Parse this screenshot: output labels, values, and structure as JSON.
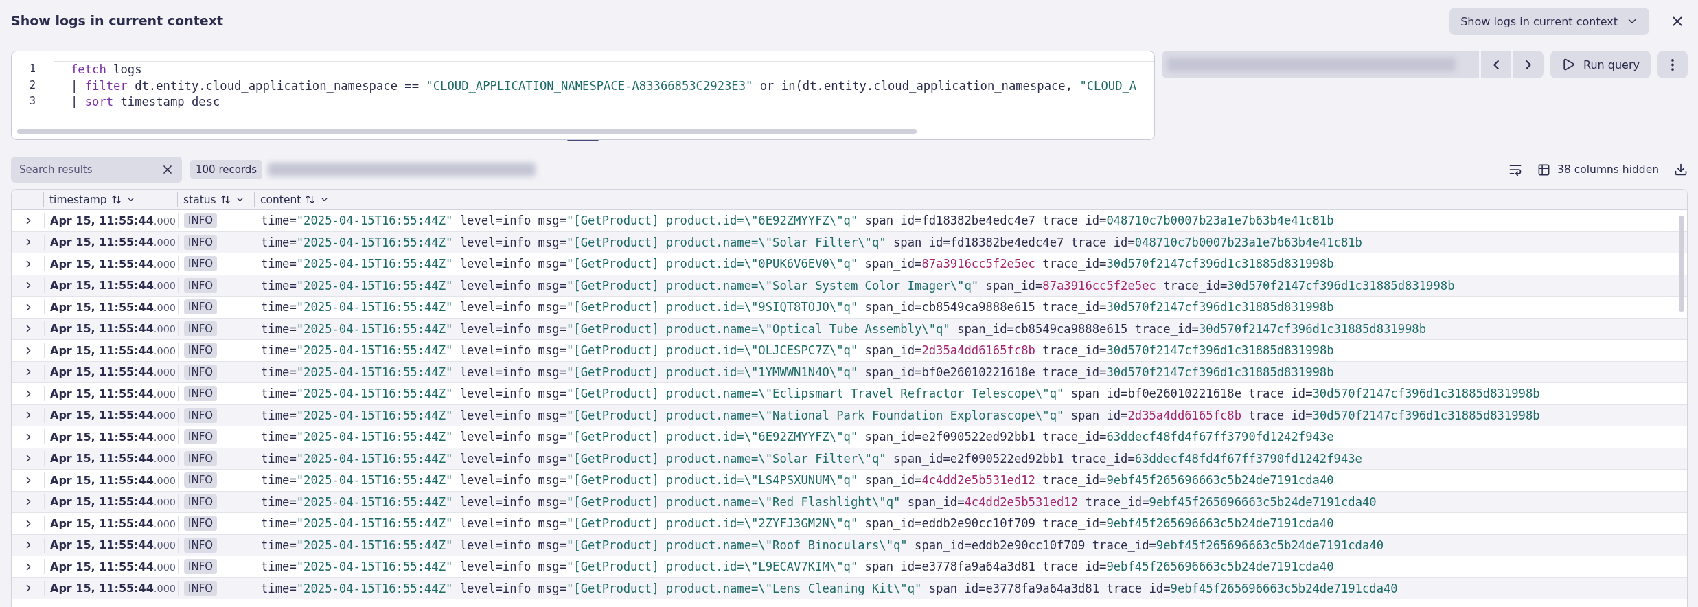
{
  "header": {
    "title": "Show logs in current context",
    "context_button": "Show logs in current context"
  },
  "editor": {
    "lines": [
      {
        "number": "1",
        "parts": [
          {
            "text": "fetch",
            "kind": "keyword"
          },
          {
            "text": " logs",
            "kind": "plain"
          }
        ]
      },
      {
        "number": "2",
        "parts": [
          {
            "text": "| ",
            "kind": "plain"
          },
          {
            "text": "filter",
            "kind": "keyword"
          },
          {
            "text": " dt.entity.cloud_application_namespace == ",
            "kind": "plain"
          },
          {
            "text": "\"CLOUD_APPLICATION_NAMESPACE-A83366853C2923E3\"",
            "kind": "string"
          },
          {
            "text": " or in(dt.entity.cloud_application_namespace, ",
            "kind": "plain"
          },
          {
            "text": "\"CLOUD_A",
            "kind": "string"
          }
        ]
      },
      {
        "number": "3",
        "parts": [
          {
            "text": "| ",
            "kind": "plain"
          },
          {
            "text": "sort",
            "kind": "keyword"
          },
          {
            "text": " timestamp desc",
            "kind": "plain"
          }
        ]
      }
    ]
  },
  "query_bar": {
    "run_button": "Run query"
  },
  "results_toolbar": {
    "search": {
      "placeholder": "Search results"
    },
    "records": "100 records",
    "hidden_columns": "38 columns hidden"
  },
  "table": {
    "columns": [
      "timestamp",
      "status",
      "content"
    ],
    "rows": [
      {
        "timestamp": "Apr 15, 11:55:44",
        "millis": ".000",
        "status": "INFO",
        "content": [
          {
            "text": "time=",
            "kind": "plain"
          },
          {
            "text": "\"2025-04-15T16:55:44Z\"",
            "kind": "string"
          },
          {
            "text": " level=info msg=",
            "kind": "plain"
          },
          {
            "text": "\"[GetProduct] product.id=\\\"6E92ZMYYFZ\\\"q\"",
            "kind": "string"
          },
          {
            "text": " span_id=fd18382be4edc4e7 trace_id=",
            "kind": "plain"
          },
          {
            "text": "048710c7b0007b23a1e7b63b4e41c81b",
            "kind": "string"
          }
        ]
      },
      {
        "timestamp": "Apr 15, 11:55:44",
        "millis": ".000",
        "status": "INFO",
        "content": [
          {
            "text": "time=",
            "kind": "plain"
          },
          {
            "text": "\"2025-04-15T16:55:44Z\"",
            "kind": "string"
          },
          {
            "text": " level=info msg=",
            "kind": "plain"
          },
          {
            "text": "\"[GetProduct] product.name=\\\"Solar Filter\\\"q\"",
            "kind": "string"
          },
          {
            "text": " span_id=fd18382be4edc4e7 trace_id=",
            "kind": "plain"
          },
          {
            "text": "048710c7b0007b23a1e7b63b4e41c81b",
            "kind": "string"
          }
        ]
      },
      {
        "timestamp": "Apr 15, 11:55:44",
        "millis": ".000",
        "status": "INFO",
        "content": [
          {
            "text": "time=",
            "kind": "plain"
          },
          {
            "text": "\"2025-04-15T16:55:44Z\"",
            "kind": "string"
          },
          {
            "text": " level=info msg=",
            "kind": "plain"
          },
          {
            "text": "\"[GetProduct] product.id=\\\"0PUK6V6EV0\\\"q\"",
            "kind": "string"
          },
          {
            "text": " span_id=",
            "kind": "plain"
          },
          {
            "text": "87a3916cc5f2e5ec",
            "kind": "highlight"
          },
          {
            "text": " trace_id=",
            "kind": "plain"
          },
          {
            "text": "30d570f2147cf396d1c31885d831998b",
            "kind": "string"
          }
        ]
      },
      {
        "timestamp": "Apr 15, 11:55:44",
        "millis": ".000",
        "status": "INFO",
        "content": [
          {
            "text": "time=",
            "kind": "plain"
          },
          {
            "text": "\"2025-04-15T16:55:44Z\"",
            "kind": "string"
          },
          {
            "text": " level=info msg=",
            "kind": "plain"
          },
          {
            "text": "\"[GetProduct] product.name=\\\"Solar System Color Imager\\\"q\"",
            "kind": "string"
          },
          {
            "text": " span_id=",
            "kind": "plain"
          },
          {
            "text": "87a3916cc5f2e5ec",
            "kind": "highlight"
          },
          {
            "text": " trace_id=",
            "kind": "plain"
          },
          {
            "text": "30d570f2147cf396d1c31885d831998b",
            "kind": "string"
          }
        ]
      },
      {
        "timestamp": "Apr 15, 11:55:44",
        "millis": ".000",
        "status": "INFO",
        "content": [
          {
            "text": "time=",
            "kind": "plain"
          },
          {
            "text": "\"2025-04-15T16:55:44Z\"",
            "kind": "string"
          },
          {
            "text": " level=info msg=",
            "kind": "plain"
          },
          {
            "text": "\"[GetProduct] product.id=\\\"9SIQT8TOJO\\\"q\"",
            "kind": "string"
          },
          {
            "text": " span_id=cb8549ca9888e615 trace_id=",
            "kind": "plain"
          },
          {
            "text": "30d570f2147cf396d1c31885d831998b",
            "kind": "string"
          }
        ]
      },
      {
        "timestamp": "Apr 15, 11:55:44",
        "millis": ".000",
        "status": "INFO",
        "content": [
          {
            "text": "time=",
            "kind": "plain"
          },
          {
            "text": "\"2025-04-15T16:55:44Z\"",
            "kind": "string"
          },
          {
            "text": " level=info msg=",
            "kind": "plain"
          },
          {
            "text": "\"[GetProduct] product.name=\\\"Optical Tube Assembly\\\"q\"",
            "kind": "string"
          },
          {
            "text": " span_id=cb8549ca9888e615 trace_id=",
            "kind": "plain"
          },
          {
            "text": "30d570f2147cf396d1c31885d831998b",
            "kind": "string"
          }
        ]
      },
      {
        "timestamp": "Apr 15, 11:55:44",
        "millis": ".000",
        "status": "INFO",
        "content": [
          {
            "text": "time=",
            "kind": "plain"
          },
          {
            "text": "\"2025-04-15T16:55:44Z\"",
            "kind": "string"
          },
          {
            "text": " level=info msg=",
            "kind": "plain"
          },
          {
            "text": "\"[GetProduct] product.id=\\\"OLJCESPC7Z\\\"q\"",
            "kind": "string"
          },
          {
            "text": " span_id=",
            "kind": "plain"
          },
          {
            "text": "2d35a4dd6165fc8b",
            "kind": "highlight"
          },
          {
            "text": " trace_id=",
            "kind": "plain"
          },
          {
            "text": "30d570f2147cf396d1c31885d831998b",
            "kind": "string"
          }
        ]
      },
      {
        "timestamp": "Apr 15, 11:55:44",
        "millis": ".000",
        "status": "INFO",
        "content": [
          {
            "text": "time=",
            "kind": "plain"
          },
          {
            "text": "\"2025-04-15T16:55:44Z\"",
            "kind": "string"
          },
          {
            "text": " level=info msg=",
            "kind": "plain"
          },
          {
            "text": "\"[GetProduct] product.id=\\\"1YMWWN1N4O\\\"q\"",
            "kind": "string"
          },
          {
            "text": " span_id=bf0e26010221618e trace_id=",
            "kind": "plain"
          },
          {
            "text": "30d570f2147cf396d1c31885d831998b",
            "kind": "string"
          }
        ]
      },
      {
        "timestamp": "Apr 15, 11:55:44",
        "millis": ".000",
        "status": "INFO",
        "content": [
          {
            "text": "time=",
            "kind": "plain"
          },
          {
            "text": "\"2025-04-15T16:55:44Z\"",
            "kind": "string"
          },
          {
            "text": " level=info msg=",
            "kind": "plain"
          },
          {
            "text": "\"[GetProduct] product.name=\\\"Eclipsmart Travel Refractor Telescope\\\"q\"",
            "kind": "string"
          },
          {
            "text": " span_id=bf0e26010221618e trace_id=",
            "kind": "plain"
          },
          {
            "text": "30d570f2147cf396d1c31885d831998b",
            "kind": "string"
          }
        ]
      },
      {
        "timestamp": "Apr 15, 11:55:44",
        "millis": ".000",
        "status": "INFO",
        "content": [
          {
            "text": "time=",
            "kind": "plain"
          },
          {
            "text": "\"2025-04-15T16:55:44Z\"",
            "kind": "string"
          },
          {
            "text": " level=info msg=",
            "kind": "plain"
          },
          {
            "text": "\"[GetProduct] product.name=\\\"National Park Foundation Explorascope\\\"q\"",
            "kind": "string"
          },
          {
            "text": " span_id=",
            "kind": "plain"
          },
          {
            "text": "2d35a4dd6165fc8b",
            "kind": "highlight"
          },
          {
            "text": " trace_id=",
            "kind": "plain"
          },
          {
            "text": "30d570f2147cf396d1c31885d831998b",
            "kind": "string"
          }
        ]
      },
      {
        "timestamp": "Apr 15, 11:55:44",
        "millis": ".000",
        "status": "INFO",
        "content": [
          {
            "text": "time=",
            "kind": "plain"
          },
          {
            "text": "\"2025-04-15T16:55:44Z\"",
            "kind": "string"
          },
          {
            "text": " level=info msg=",
            "kind": "plain"
          },
          {
            "text": "\"[GetProduct] product.id=\\\"6E92ZMYYFZ\\\"q\"",
            "kind": "string"
          },
          {
            "text": " span_id=e2f090522ed92bb1 trace_id=",
            "kind": "plain"
          },
          {
            "text": "63ddecf48fd4f67ff3790fd1242f943e",
            "kind": "string"
          }
        ]
      },
      {
        "timestamp": "Apr 15, 11:55:44",
        "millis": ".000",
        "status": "INFO",
        "content": [
          {
            "text": "time=",
            "kind": "plain"
          },
          {
            "text": "\"2025-04-15T16:55:44Z\"",
            "kind": "string"
          },
          {
            "text": " level=info msg=",
            "kind": "plain"
          },
          {
            "text": "\"[GetProduct] product.name=\\\"Solar Filter\\\"q\"",
            "kind": "string"
          },
          {
            "text": " span_id=e2f090522ed92bb1 trace_id=",
            "kind": "plain"
          },
          {
            "text": "63ddecf48fd4f67ff3790fd1242f943e",
            "kind": "string"
          }
        ]
      },
      {
        "timestamp": "Apr 15, 11:55:44",
        "millis": ".000",
        "status": "INFO",
        "content": [
          {
            "text": "time=",
            "kind": "plain"
          },
          {
            "text": "\"2025-04-15T16:55:44Z\"",
            "kind": "string"
          },
          {
            "text": " level=info msg=",
            "kind": "plain"
          },
          {
            "text": "\"[GetProduct] product.id=\\\"LS4PSXUNUM\\\"q\"",
            "kind": "string"
          },
          {
            "text": " span_id=",
            "kind": "plain"
          },
          {
            "text": "4c4dd2e5b531ed12",
            "kind": "highlight"
          },
          {
            "text": " trace_id=",
            "kind": "plain"
          },
          {
            "text": "9ebf45f265696663c5b24de7191cda40",
            "kind": "string"
          }
        ]
      },
      {
        "timestamp": "Apr 15, 11:55:44",
        "millis": ".000",
        "status": "INFO",
        "content": [
          {
            "text": "time=",
            "kind": "plain"
          },
          {
            "text": "\"2025-04-15T16:55:44Z\"",
            "kind": "string"
          },
          {
            "text": " level=info msg=",
            "kind": "plain"
          },
          {
            "text": "\"[GetProduct] product.name=\\\"Red Flashlight\\\"q\"",
            "kind": "string"
          },
          {
            "text": " span_id=",
            "kind": "plain"
          },
          {
            "text": "4c4dd2e5b531ed12",
            "kind": "highlight"
          },
          {
            "text": " trace_id=",
            "kind": "plain"
          },
          {
            "text": "9ebf45f265696663c5b24de7191cda40",
            "kind": "string"
          }
        ]
      },
      {
        "timestamp": "Apr 15, 11:55:44",
        "millis": ".000",
        "status": "INFO",
        "content": [
          {
            "text": "time=",
            "kind": "plain"
          },
          {
            "text": "\"2025-04-15T16:55:44Z\"",
            "kind": "string"
          },
          {
            "text": " level=info msg=",
            "kind": "plain"
          },
          {
            "text": "\"[GetProduct] product.id=\\\"2ZYFJ3GM2N\\\"q\"",
            "kind": "string"
          },
          {
            "text": " span_id=eddb2e90cc10f709 trace_id=",
            "kind": "plain"
          },
          {
            "text": "9ebf45f265696663c5b24de7191cda40",
            "kind": "string"
          }
        ]
      },
      {
        "timestamp": "Apr 15, 11:55:44",
        "millis": ".000",
        "status": "INFO",
        "content": [
          {
            "text": "time=",
            "kind": "plain"
          },
          {
            "text": "\"2025-04-15T16:55:44Z\"",
            "kind": "string"
          },
          {
            "text": " level=info msg=",
            "kind": "plain"
          },
          {
            "text": "\"[GetProduct] product.name=\\\"Roof Binoculars\\\"q\"",
            "kind": "string"
          },
          {
            "text": " span_id=eddb2e90cc10f709 trace_id=",
            "kind": "plain"
          },
          {
            "text": "9ebf45f265696663c5b24de7191cda40",
            "kind": "string"
          }
        ]
      },
      {
        "timestamp": "Apr 15, 11:55:44",
        "millis": ".000",
        "status": "INFO",
        "content": [
          {
            "text": "time=",
            "kind": "plain"
          },
          {
            "text": "\"2025-04-15T16:55:44Z\"",
            "kind": "string"
          },
          {
            "text": " level=info msg=",
            "kind": "plain"
          },
          {
            "text": "\"[GetProduct] product.id=\\\"L9ECAV7KIM\\\"q\"",
            "kind": "string"
          },
          {
            "text": " span_id=e3778fa9a64a3d81 trace_id=",
            "kind": "plain"
          },
          {
            "text": "9ebf45f265696663c5b24de7191cda40",
            "kind": "string"
          }
        ]
      },
      {
        "timestamp": "Apr 15, 11:55:44",
        "millis": ".000",
        "status": "INFO",
        "content": [
          {
            "text": "time=",
            "kind": "plain"
          },
          {
            "text": "\"2025-04-15T16:55:44Z\"",
            "kind": "string"
          },
          {
            "text": " level=info msg=",
            "kind": "plain"
          },
          {
            "text": "\"[GetProduct] product.name=\\\"Lens Cleaning Kit\\\"q\"",
            "kind": "string"
          },
          {
            "text": " span_id=e3778fa9a64a3d81 trace_id=",
            "kind": "plain"
          },
          {
            "text": "9ebf45f265696663c5b24de7191cda40",
            "kind": "string"
          }
        ]
      }
    ]
  }
}
